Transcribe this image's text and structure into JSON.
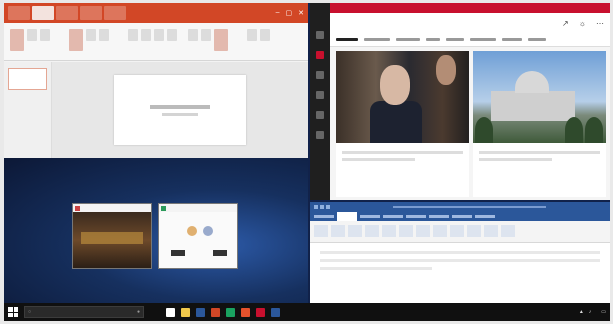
{
  "powerpoint": {
    "accent_color": "#d24726",
    "window_buttons": [
      "–",
      "▢",
      "✕"
    ]
  },
  "news_app": {
    "accent_color": "#c8102e",
    "icons": [
      "menu-icon",
      "home-icon",
      "bookmark-icon",
      "settings-icon"
    ],
    "header_icons": [
      "share-icon",
      "lightbulb-icon",
      "more-icon"
    ]
  },
  "word": {
    "accent_color": "#2b579a"
  },
  "taskbar": {
    "search_placeholder": "",
    "app_colors": [
      "#ffffff",
      "#f2c94c",
      "#2b579a",
      "#d24726",
      "#1aa260",
      "#e6522c",
      "#c8102e",
      "#2b579a"
    ],
    "clock_time": "",
    "clock_date": ""
  }
}
